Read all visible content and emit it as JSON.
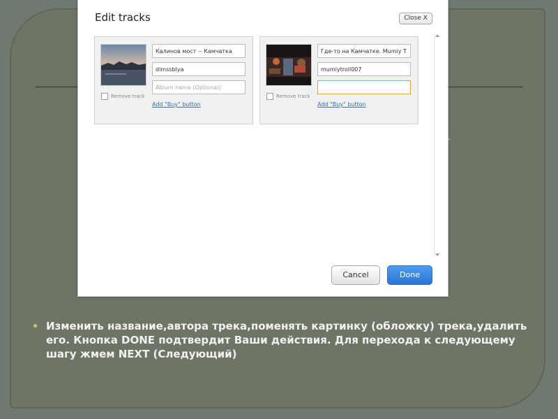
{
  "dialog": {
    "title": "Edit tracks",
    "close_label": "Close X",
    "cancel_label": "Cancel",
    "done_label": "Done"
  },
  "tracks": [
    {
      "title_value": "Калинов мост -- Камчатка",
      "artist_value": "dimssblya",
      "album_value": "",
      "album_placeholder": "Album name (Optional)",
      "remove_label": "Remove track",
      "buy_link": "Add \"Buy\" button"
    },
    {
      "title_value": "Где-то на Камчатке. Mumiy T",
      "artist_value": "mumiytroll007",
      "album_value": "",
      "album_placeholder": "",
      "remove_label": "Remove track",
      "buy_link": "Add \"Buy\" button"
    }
  ],
  "slide": {
    "bullet_text": "Изменить название,автора трека,поменять картинку (обложку) трека,удалить его. Кнопка DONE подтвердит Ваши действия. Для перехода к следующему шагу жмем NEXT (Следующий)"
  },
  "colors": {
    "slide_background": "#6e7566",
    "accent": "#2a74d3",
    "focus": "#e0a040"
  }
}
